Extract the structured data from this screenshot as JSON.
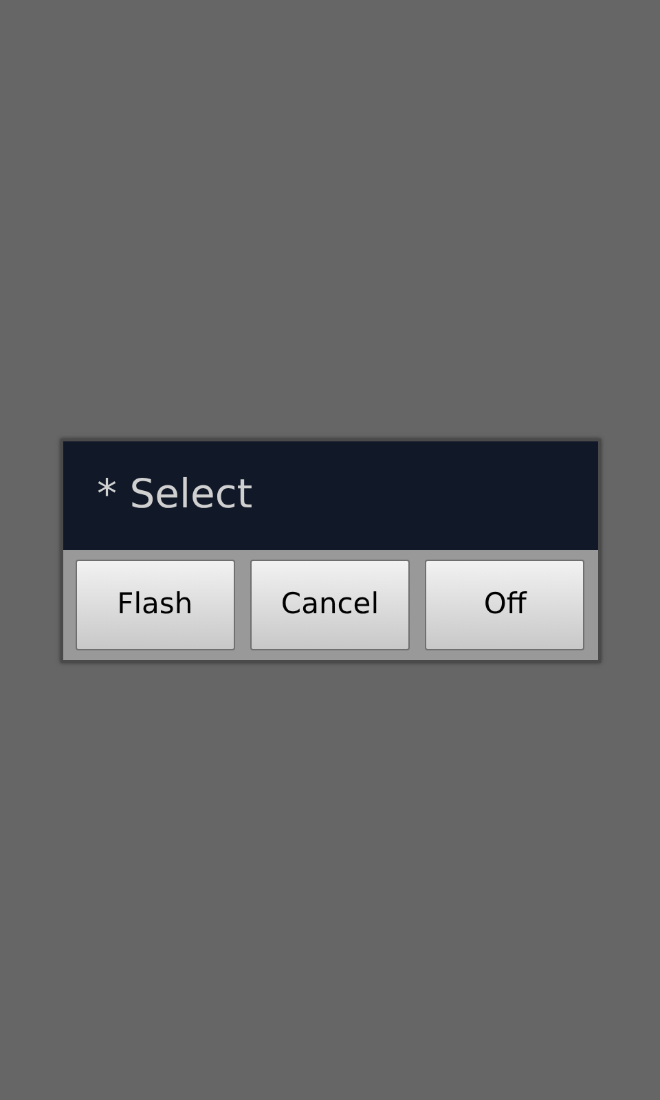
{
  "dialog": {
    "title": "* Select",
    "buttons": [
      "Flash",
      "Cancel",
      "Off"
    ]
  }
}
